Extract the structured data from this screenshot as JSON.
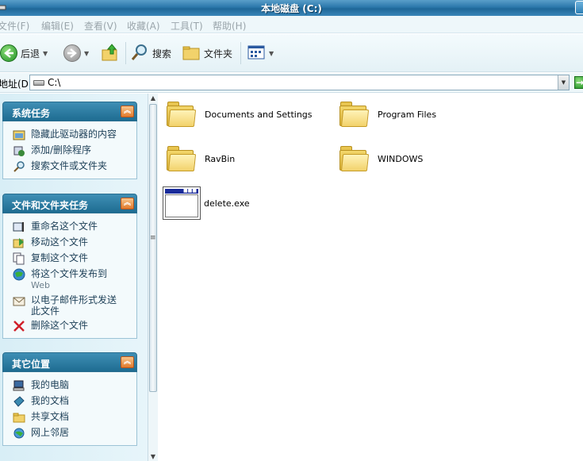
{
  "window": {
    "title": "本地磁盘 (C:)"
  },
  "menu": [
    "文件(F)",
    "编辑(E)",
    "查看(V)",
    "收藏(A)",
    "工具(T)",
    "帮助(H)"
  ],
  "toolbar": {
    "back_label": "后退",
    "search_label": "搜索",
    "folders_label": "文件夹"
  },
  "address": {
    "label": "地址(D)",
    "value": "C:\\"
  },
  "panels": {
    "system_tasks": {
      "title": "系统任务",
      "items": [
        "隐藏此驱动器的内容",
        "添加/删除程序",
        "搜索文件或文件夹"
      ]
    },
    "file_tasks": {
      "title": "文件和文件夹任务",
      "items": [
        "重命名这个文件",
        "移动这个文件",
        "复制这个文件",
        "将这个文件发布到",
        "以电子邮件形式发送",
        "删除这个文件"
      ],
      "publish_sub": "Web",
      "email_line2": "此文件"
    },
    "other_places": {
      "title": "其它位置",
      "items": [
        "我的电脑",
        "我的文档",
        "共享文档",
        "网上邻居"
      ]
    }
  },
  "files": [
    {
      "name": "Documents and Settings",
      "type": "folder"
    },
    {
      "name": "Program Files",
      "type": "folder"
    },
    {
      "name": "RavBin",
      "type": "folder"
    },
    {
      "name": "WINDOWS",
      "type": "folder"
    },
    {
      "name": "delete.exe",
      "type": "exe"
    }
  ],
  "icons": {
    "back": "back-arrow-icon",
    "forward": "forward-arrow-icon",
    "up": "up-folder-icon",
    "search": "magnifier-icon",
    "folders": "folders-icon",
    "views": "views-icon"
  }
}
